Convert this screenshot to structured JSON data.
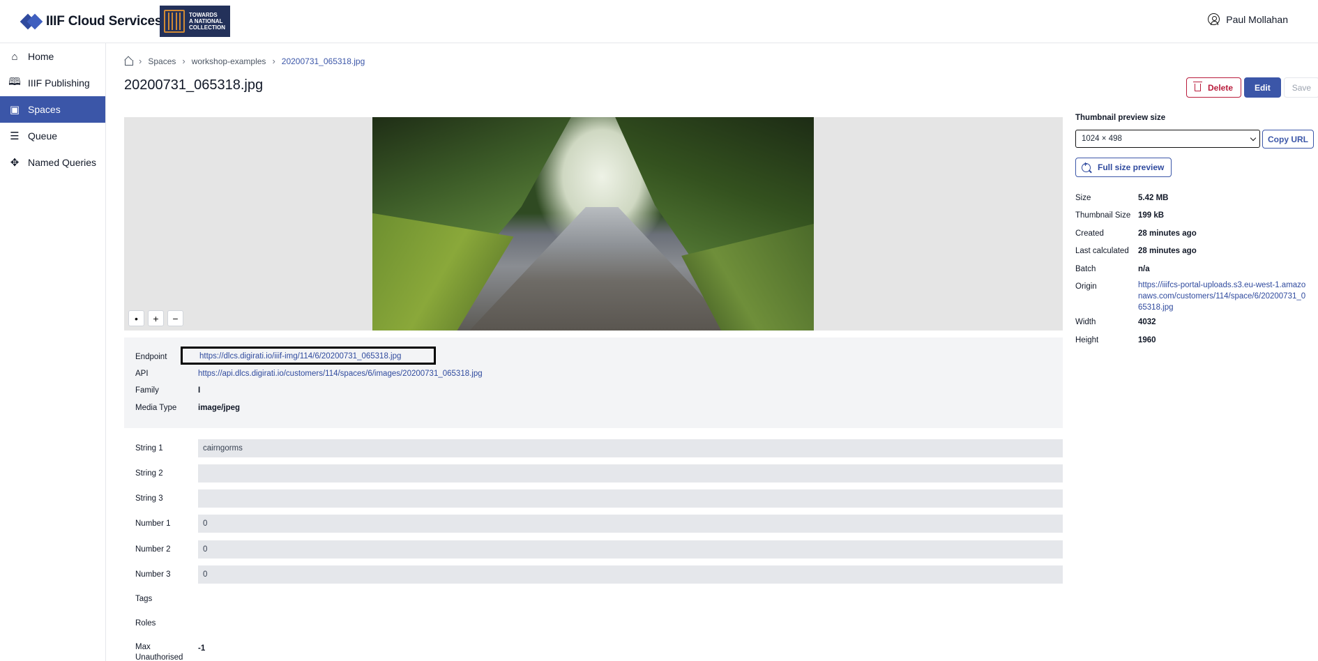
{
  "header": {
    "app_name": "IIIF Cloud Services",
    "partner_logo_text": "TOWARDS A NATIONAL COLLECTION",
    "user_name": "Paul Mollahan"
  },
  "sidebar": {
    "items": [
      {
        "label": "Home",
        "icon": "home-icon",
        "active": false
      },
      {
        "label": "IIIF Publishing",
        "icon": "book-icon",
        "active": false
      },
      {
        "label": "Spaces",
        "icon": "images-icon",
        "active": true
      },
      {
        "label": "Queue",
        "icon": "list-icon",
        "active": false
      },
      {
        "label": "Named Queries",
        "icon": "query-icon",
        "active": false
      }
    ]
  },
  "breadcrumb": {
    "items": [
      "Spaces",
      "workshop-examples"
    ],
    "current": "20200731_065318.jpg"
  },
  "page": {
    "title": "20200731_065318.jpg"
  },
  "actions": {
    "delete_label": "Delete",
    "edit_label": "Edit",
    "save_label": "Save"
  },
  "viewer": {
    "reset_label": "•",
    "zoom_in_label": "+",
    "zoom_out_label": "−"
  },
  "info": {
    "endpoint_label": "Endpoint",
    "endpoint_value": "https://dlcs.digirati.io/iiif-img/114/6/20200731_065318.jpg",
    "api_label": "API",
    "api_value": "https://api.dlcs.digirati.io/customers/114/spaces/6/images/20200731_065318.jpg",
    "family_label": "Family",
    "family_value": "I",
    "media_type_label": "Media Type",
    "media_type_value": "image/jpeg"
  },
  "fields": {
    "string1_label": "String 1",
    "string1_value": "cairngorms",
    "string2_label": "String 2",
    "string2_value": "",
    "string3_label": "String 3",
    "string3_value": "",
    "number1_label": "Number 1",
    "number1_value": "0",
    "number2_label": "Number 2",
    "number2_value": "0",
    "number3_label": "Number 3",
    "number3_value": "0",
    "tags_label": "Tags",
    "roles_label": "Roles",
    "max_unauth_label": "Max Unauthorised",
    "max_unauth_value": "-1"
  },
  "right_panel": {
    "thumb_title": "Thumbnail preview size",
    "thumb_selected": "1024 × 498",
    "copy_url_label": "Copy URL",
    "full_preview_label": "Full size preview",
    "meta": {
      "size_label": "Size",
      "size_value": "5.42 MB",
      "thumb_size_label": "Thumbnail Size",
      "thumb_size_value": "199 kB",
      "created_label": "Created",
      "created_value": "28 minutes ago",
      "last_calc_label": "Last calculated",
      "last_calc_value": "28 minutes ago",
      "batch_label": "Batch",
      "batch_value": "n/a",
      "origin_label": "Origin",
      "origin_value": "https://iiifcs-portal-uploads.s3.eu-west-1.amazonaws.com/customers/114/space/6/20200731_065318.jpg",
      "width_label": "Width",
      "width_value": "4032",
      "height_label": "Height",
      "height_value": "1960"
    }
  },
  "colors": {
    "accent": "#3b56a8",
    "danger": "#b91c3c",
    "panel_bg": "#f3f4f6",
    "input_bg": "#e5e7eb"
  }
}
